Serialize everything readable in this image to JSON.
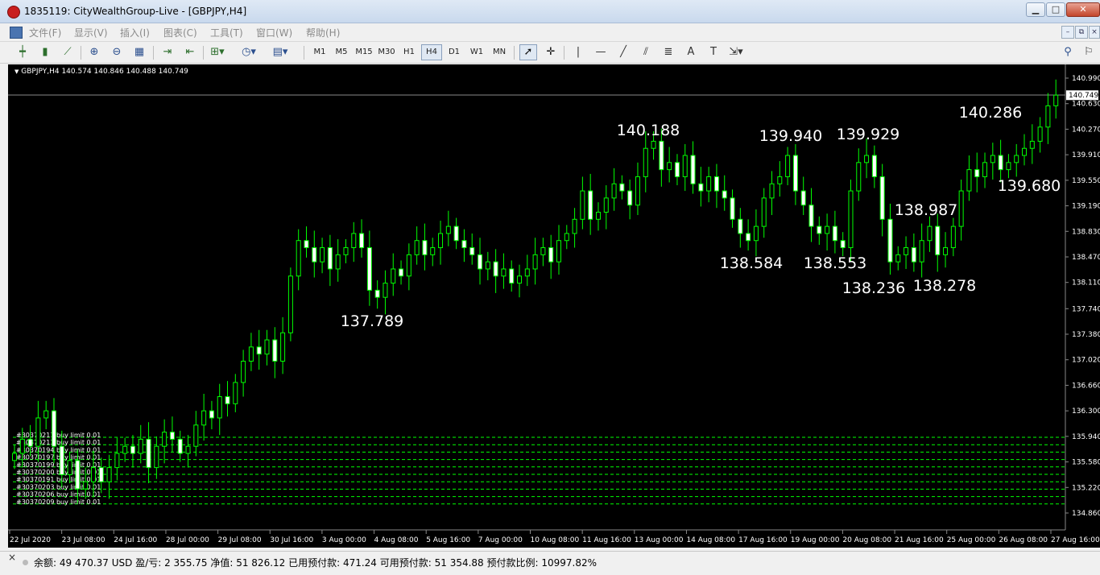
{
  "window": {
    "title": "1835119: CityWealthGroup-Live - [GBPJPY,H4]",
    "minimize": "▁",
    "maximize": "□",
    "close": "✕",
    "mdi_min": "–",
    "mdi_restore": "⧉",
    "mdi_close": "×"
  },
  "menu": [
    "文件(F)",
    "显示(V)",
    "插入(I)",
    "图表(C)",
    "工具(T)",
    "窗口(W)",
    "帮助(H)"
  ],
  "toolbar": {
    "timeframes": [
      "M1",
      "M5",
      "M15",
      "M30",
      "H1",
      "H4",
      "D1",
      "W1",
      "MN"
    ],
    "active_timeframe": "H4",
    "icons": [
      "bar-chart-icon",
      "candles-icon",
      "line-chart-icon",
      "zoom-in-icon",
      "zoom-out-icon",
      "tile-windows-icon",
      "autoscroll-icon",
      "chart-shift-icon",
      "new-order-icon",
      "periods-icon",
      "templates-icon",
      "cursor-icon",
      "crosshair-icon",
      "vertical-line-icon",
      "horizontal-line-icon",
      "trendline-icon",
      "channel-icon",
      "fibonacci-icon",
      "text-icon",
      "label-icon",
      "arrows-icon",
      "search-icon",
      "flag-icon"
    ]
  },
  "chart": {
    "symbol_header": "GBPJPY,H4  140.574 140.846 140.488 140.749",
    "current_price": "140.749",
    "colors": {
      "background": "#000000",
      "candle_line": "#00ff00",
      "candle_bull": "#000000",
      "candle_bear": "#ffffff",
      "order_line": "#00ff00",
      "annotation": "#ffffff",
      "bid_line": "#999999"
    },
    "annotations": [
      {
        "text": "137.789"
      },
      {
        "text": "140.188"
      },
      {
        "text": "139.940"
      },
      {
        "text": "139.929"
      },
      {
        "text": "140.286"
      },
      {
        "text": "139.680"
      },
      {
        "text": "138.987"
      },
      {
        "text": "138.584"
      },
      {
        "text": "138.553"
      },
      {
        "text": "138.236"
      },
      {
        "text": "138.278"
      }
    ],
    "orders": [
      "#30370211 buy limit 0.01",
      "#30370213 buy limit 0.01",
      "#30370194 buy limit 0.01",
      "#30370197 buy limit 0.01",
      "#30370199 buy limit 0.01",
      "#30370200 buy limit 0.01",
      "#30370191 buy limit 0.01",
      "#30370203 buy limit 0.01",
      "#30370206 buy limit 0.01",
      "#30370209 buy limit 0.01"
    ]
  },
  "chart_data": {
    "type": "candlestick",
    "title": "GBPJPY,H4",
    "ylim": [
      134.86,
      141.13
    ],
    "y_ticks": [
      "140.990",
      "140.630",
      "140.270",
      "139.910",
      "139.550",
      "139.190",
      "138.830",
      "138.470",
      "138.110",
      "137.740",
      "137.380",
      "137.020",
      "136.660",
      "136.300",
      "135.940",
      "135.580",
      "135.220",
      "134.860"
    ],
    "x_ticks": [
      "22 Jul 2020",
      "23 Jul 08:00",
      "24 Jul 16:00",
      "28 Jul 00:00",
      "29 Jul 08:00",
      "30 Jul 16:00",
      "3 Aug 00:00",
      "4 Aug 08:00",
      "5 Aug 16:00",
      "7 Aug 00:00",
      "10 Aug 08:00",
      "11 Aug 16:00",
      "13 Aug 00:00",
      "14 Aug 08:00",
      "17 Aug 16:00",
      "19 Aug 00:00",
      "20 Aug 08:00",
      "21 Aug 16:00",
      "25 Aug 00:00",
      "26 Aug 08:00",
      "27 Aug 16:00"
    ],
    "grid": false,
    "close_path": [
      135.7,
      135.9,
      135.8,
      136.2,
      136.3,
      135.8,
      135.4,
      135.6,
      135.2,
      135.3,
      135.5,
      135.3,
      135.5,
      135.7,
      135.8,
      135.7,
      135.9,
      135.5,
      135.8,
      136.0,
      135.9,
      135.7,
      135.8,
      136.1,
      136.3,
      136.2,
      136.5,
      136.4,
      136.7,
      137.0,
      137.2,
      137.1,
      137.3,
      137.0,
      137.4,
      138.2,
      138.7,
      138.6,
      138.4,
      138.6,
      138.3,
      138.5,
      138.6,
      138.8,
      138.6,
      138.0,
      137.9,
      138.1,
      138.3,
      138.2,
      138.5,
      138.7,
      138.5,
      138.6,
      138.8,
      138.9,
      138.7,
      138.6,
      138.5,
      138.3,
      138.4,
      138.2,
      138.3,
      138.1,
      138.2,
      138.3,
      138.5,
      138.6,
      138.4,
      138.7,
      138.8,
      139.0,
      139.4,
      139.0,
      139.1,
      139.3,
      139.5,
      139.4,
      139.2,
      139.6,
      140.0,
      140.1,
      139.7,
      139.8,
      139.6,
      139.9,
      139.5,
      139.4,
      139.6,
      139.4,
      139.3,
      139.0,
      138.8,
      138.7,
      138.9,
      139.3,
      139.5,
      139.6,
      139.9,
      139.4,
      139.2,
      138.9,
      138.8,
      138.9,
      138.7,
      138.6,
      139.4,
      139.8,
      139.9,
      139.6,
      139.0,
      138.4,
      138.5,
      138.6,
      138.4,
      138.7,
      138.9,
      138.5,
      138.6,
      138.9,
      139.4,
      139.7,
      139.6,
      139.8,
      139.9,
      139.7,
      139.8,
      139.9,
      140.0,
      140.1,
      140.3,
      140.6,
      140.75
    ]
  },
  "status": {
    "text": "余额: 49 470.37 USD  盈/亏: 2 355.75  净值: 51 826.12  已用预付款: 471.24  可用预付款: 51 354.88  预付款比例: 10997.82%"
  }
}
